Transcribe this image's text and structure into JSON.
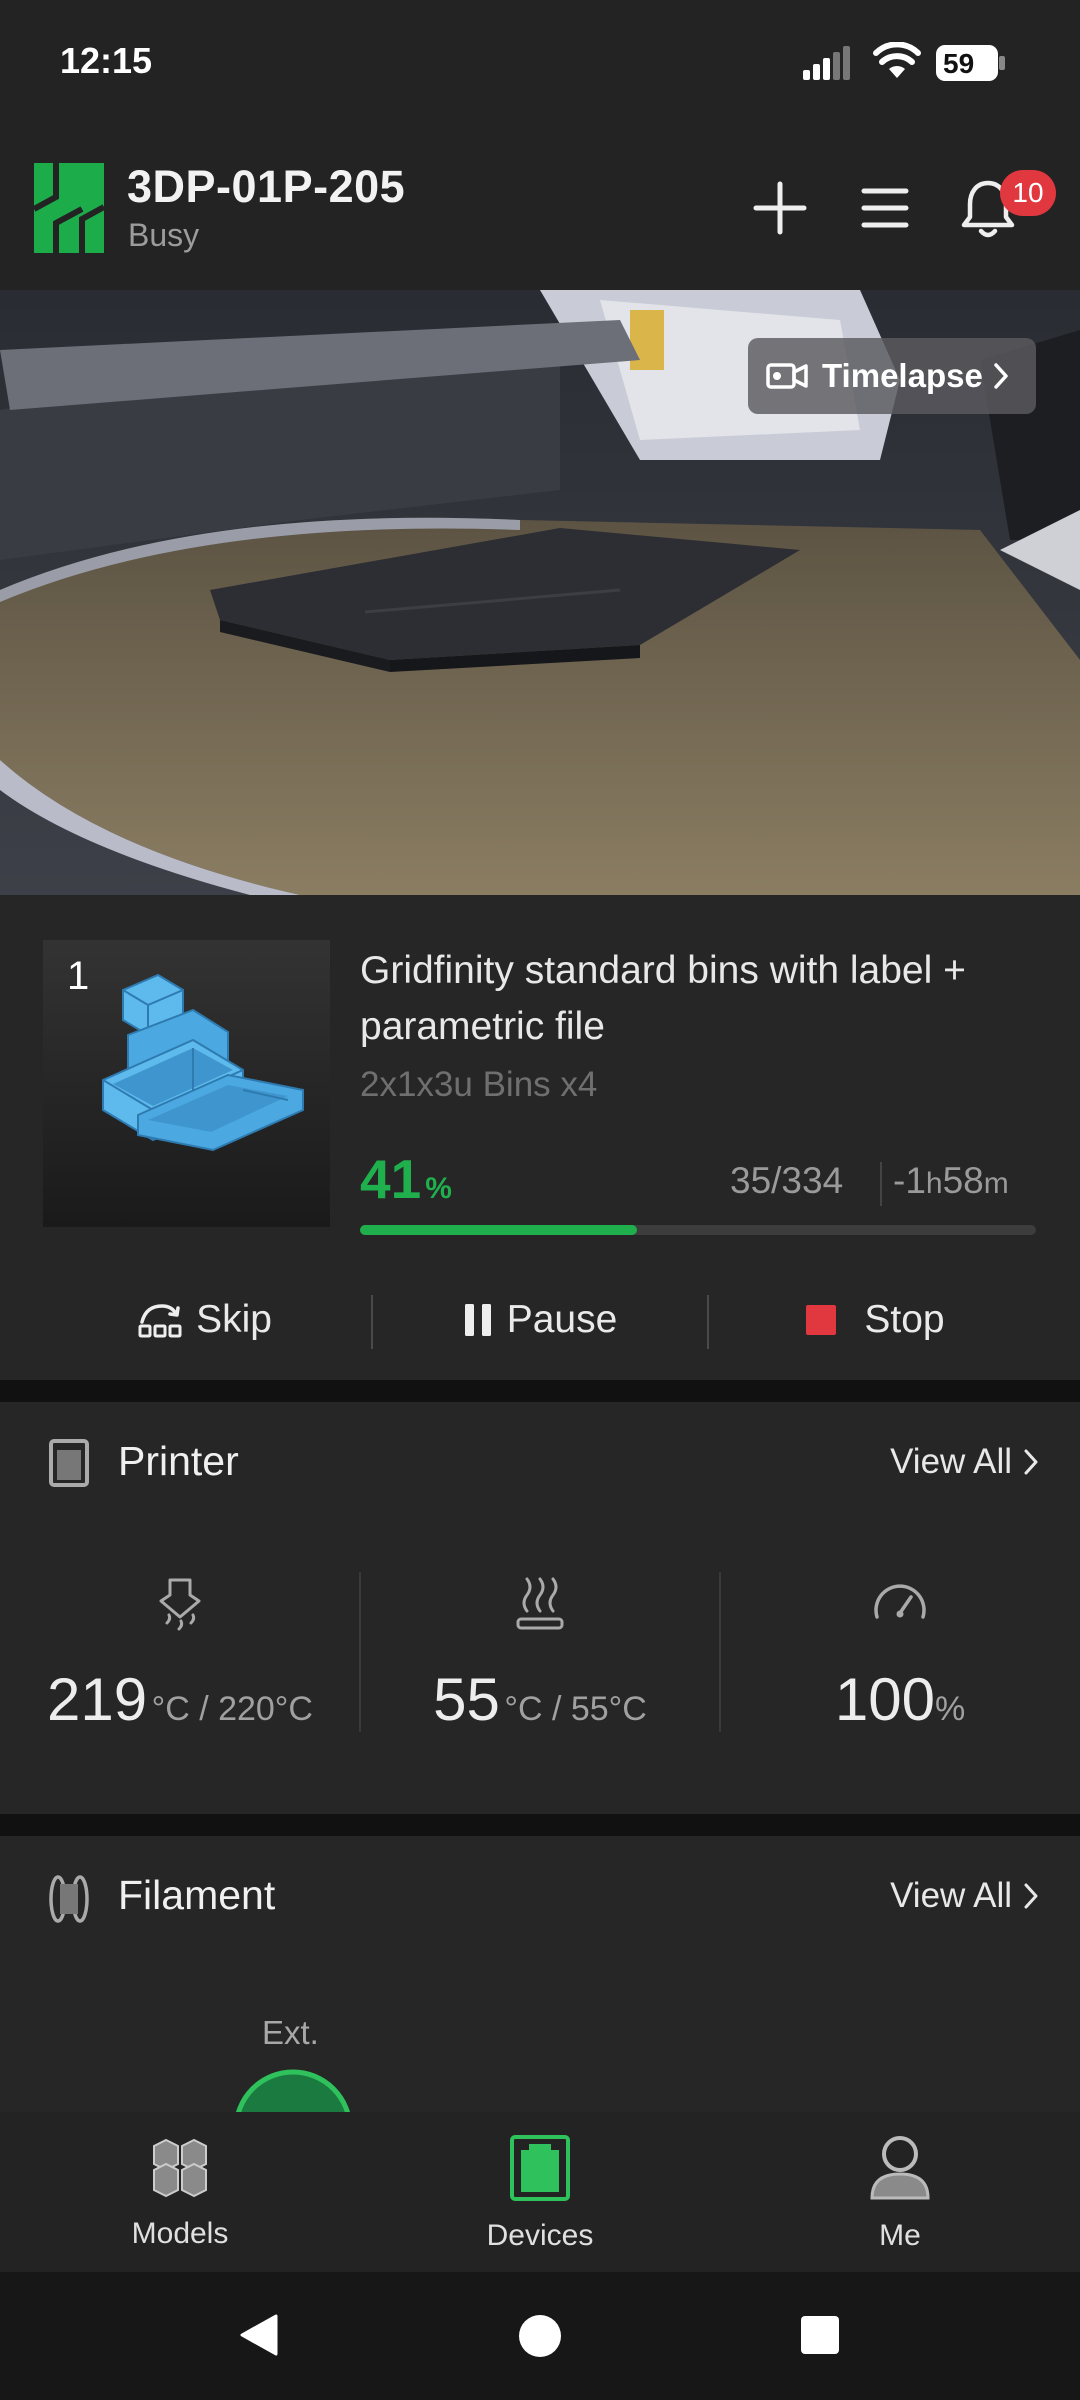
{
  "status_bar": {
    "time": "12:15",
    "battery": "59"
  },
  "header": {
    "title": "3DP-01P-205",
    "status": "Busy",
    "notification_count": "10"
  },
  "camera": {
    "timelapse_label": "Timelapse"
  },
  "job": {
    "plate_number": "1",
    "title": "Gridfinity standard bins with label + parametric file",
    "subtitle": "2x1x3u Bins x4",
    "progress_value": "41",
    "progress_unit": "%",
    "progress_fraction": 0.41,
    "layers": "35/334",
    "remaining_prefix": "-1",
    "remaining_h": "h",
    "remaining_min": "58",
    "remaining_m": "m",
    "actions": {
      "skip": "Skip",
      "pause": "Pause",
      "stop": "Stop"
    }
  },
  "printer": {
    "title": "Printer",
    "view_all": "View All",
    "nozzle": {
      "value": "219",
      "unit": "°C / 220°C"
    },
    "bed": {
      "value": "55",
      "unit": "°C / 55°C"
    },
    "speed": {
      "value": "100",
      "unit": "%"
    }
  },
  "filament": {
    "title": "Filament",
    "view_all": "View All",
    "ext_label": "Ext."
  },
  "colors": {
    "accent": "#1fb04d",
    "stop": "#e0383e",
    "badge": "#e0383e"
  },
  "nav": {
    "models": "Models",
    "devices": "Devices",
    "me": "Me"
  }
}
